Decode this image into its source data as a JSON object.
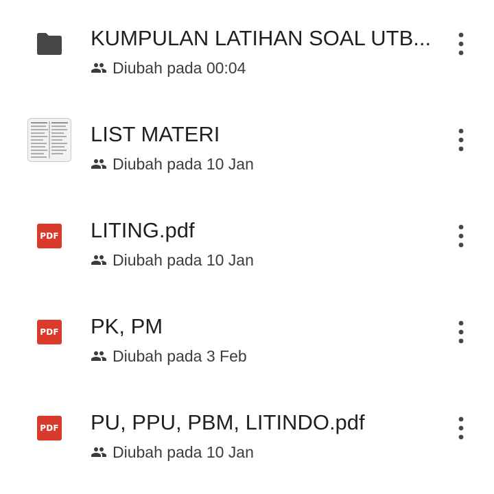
{
  "files": [
    {
      "type": "folder",
      "icon": "folder-icon",
      "name": "KUMPULAN LATIHAN SOAL UTB...",
      "modified": "Diubah pada 00:04"
    },
    {
      "type": "document",
      "icon": "document-thumbnail",
      "name": "LIST MATERI",
      "modified": "Diubah pada 10 Jan"
    },
    {
      "type": "pdf",
      "icon": "pdf-icon",
      "badge": "PDF",
      "name": "LITING.pdf",
      "modified": "Diubah pada 10 Jan"
    },
    {
      "type": "pdf",
      "icon": "pdf-icon",
      "badge": "PDF",
      "name": "PK, PM",
      "modified": "Diubah pada 3 Feb"
    },
    {
      "type": "pdf",
      "icon": "pdf-icon",
      "badge": "PDF",
      "name": "PU, PPU, PBM, LITINDO.pdf",
      "modified": "Diubah pada 10 Jan"
    }
  ],
  "colors": {
    "pdf": "#d93a2b",
    "folder": "#444746",
    "text_primary": "#1f1f1f",
    "text_secondary": "#3c3c3c"
  }
}
